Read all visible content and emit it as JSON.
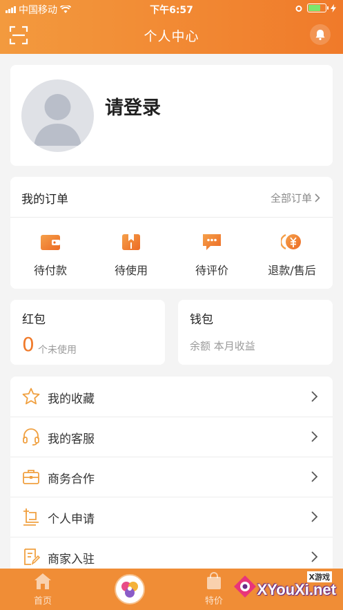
{
  "status_bar": {
    "carrier": "中国移动",
    "time": "下午6:57"
  },
  "header": {
    "title": "个人中心",
    "scan_icon": "scan-icon",
    "bell_icon": "bell-icon"
  },
  "profile": {
    "login_text": "请登录",
    "avatar_icon": "user-avatar-icon"
  },
  "orders": {
    "title": "我的订单",
    "all_label": "全部订单",
    "items": [
      {
        "label": "待付款",
        "icon": "wallet-icon"
      },
      {
        "label": "待使用",
        "icon": "ticket-icon"
      },
      {
        "label": "待评价",
        "icon": "comment-icon"
      },
      {
        "label": "退款/售后",
        "icon": "refund-yen-icon"
      }
    ]
  },
  "red_packet": {
    "title": "红包",
    "count": "0",
    "sub": "个未使用"
  },
  "wallet": {
    "title": "钱包",
    "sub": "余额 本月收益"
  },
  "menu": {
    "items": [
      {
        "label": "我的收藏",
        "icon": "star-icon"
      },
      {
        "label": "我的客服",
        "icon": "headset-icon"
      },
      {
        "label": "商务合作",
        "icon": "briefcase-icon"
      },
      {
        "label": "个人申请",
        "icon": "application-icon"
      },
      {
        "label": "商家入驻",
        "icon": "merchant-doc-icon"
      }
    ]
  },
  "tabbar": {
    "tabs": [
      {
        "label": "首页",
        "icon": "home-icon"
      },
      {
        "label": "特价",
        "icon": "shopping-bag-icon"
      }
    ]
  },
  "watermark": {
    "small": "X游戏",
    "big": "XYouXi.net"
  },
  "colors": {
    "accent": "#f07a2a",
    "header_start": "#f39a3e",
    "tabbar": "#f08d36",
    "background": "#f4f4f4"
  }
}
